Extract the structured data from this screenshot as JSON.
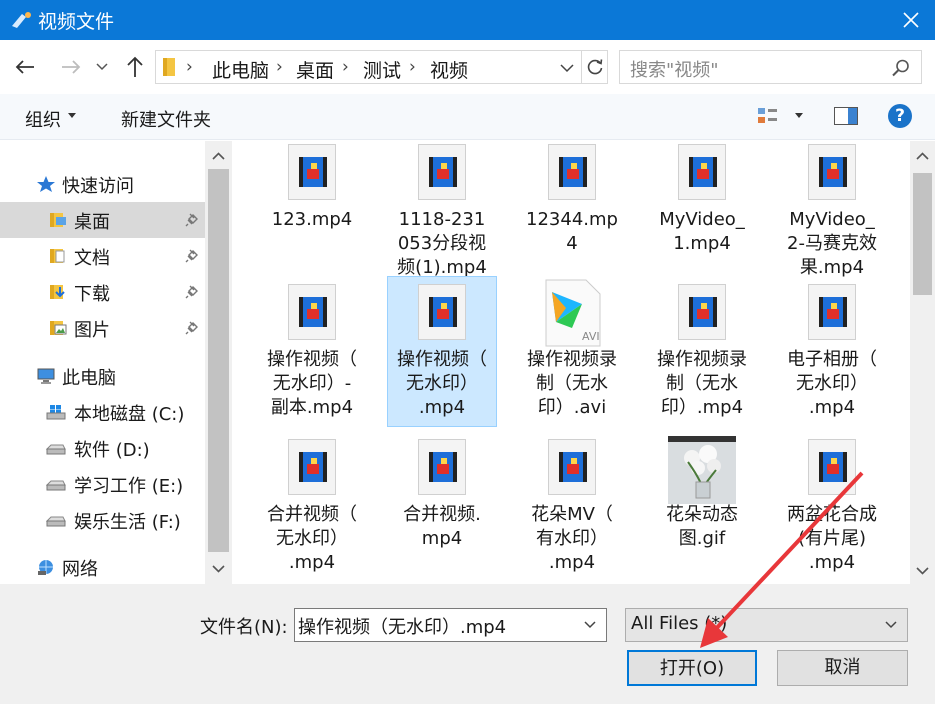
{
  "window": {
    "title": "视频文件"
  },
  "address": {
    "crumbs": [
      "此电脑",
      "桌面",
      "测试",
      "视频"
    ],
    "search_placeholder": "搜索\"视频\""
  },
  "toolbar": {
    "organize_label": "组织",
    "new_folder_label": "新建文件夹"
  },
  "nav": {
    "quick_access": "快速访问",
    "items": [
      {
        "label": "桌面"
      },
      {
        "label": "文档"
      },
      {
        "label": "下载"
      },
      {
        "label": "图片"
      }
    ],
    "this_pc": "此电脑",
    "drives": [
      {
        "label": "本地磁盘 (C:)"
      },
      {
        "label": "软件 (D:)"
      },
      {
        "label": "学习工作 (E:)"
      },
      {
        "label": "娱乐生活 (F:)"
      }
    ],
    "network": "网络"
  },
  "files": [
    {
      "lines": [
        "123.mp4"
      ],
      "icon": "video-file-icon"
    },
    {
      "lines": [
        "1118-231",
        "053分段视",
        "频(1).mp4"
      ],
      "icon": "video-file-icon"
    },
    {
      "lines": [
        "12344.mp",
        "4"
      ],
      "icon": "video-file-icon"
    },
    {
      "lines": [
        "MyVideo_",
        "1.mp4"
      ],
      "icon": "video-file-icon"
    },
    {
      "lines": [
        "MyVideo_",
        "2-马赛克效",
        "果.mp4"
      ],
      "icon": "video-file-icon"
    },
    {
      "lines": [
        "操作视频（",
        "无水印）-",
        "副本.mp4"
      ],
      "icon": "video-file-icon"
    },
    {
      "lines": [
        "操作视频（",
        "无水印）",
        ".mp4"
      ],
      "icon": "video-file-icon",
      "selected": true
    },
    {
      "lines": [
        "操作视频录",
        "制（无水",
        "印）.avi"
      ],
      "icon": "tencent-video-avi-icon"
    },
    {
      "lines": [
        "操作视频录",
        "制（无水",
        "印）.mp4"
      ],
      "icon": "video-file-icon"
    },
    {
      "lines": [
        "电子相册（",
        "无水印）",
        ".mp4"
      ],
      "icon": "video-file-icon"
    },
    {
      "lines": [
        "合并视频（",
        "无水印）",
        ".mp4"
      ],
      "icon": "video-file-icon"
    },
    {
      "lines": [
        "合并视频.",
        "mp4"
      ],
      "icon": "video-file-icon"
    },
    {
      "lines": [
        "花朵MV（",
        "有水印）",
        ".mp4"
      ],
      "icon": "video-file-icon"
    },
    {
      "lines": [
        "花朵动态",
        "图.gif"
      ],
      "icon": "flower-photo-thumbnail"
    },
    {
      "lines": [
        "两盆花合成",
        "(有片尾)",
        ".mp4"
      ],
      "icon": "video-file-icon"
    }
  ],
  "bottom": {
    "filename_label": "文件名(N):",
    "filename_value": "操作视频（无水印）.mp4",
    "filter_value": "All Files (*)",
    "open_label": "打开(O)",
    "cancel_label": "取消"
  },
  "colors": {
    "titlebar": "#0b78d7",
    "selection": "#cce8ff",
    "annotation_arrow": "#e8373a"
  }
}
